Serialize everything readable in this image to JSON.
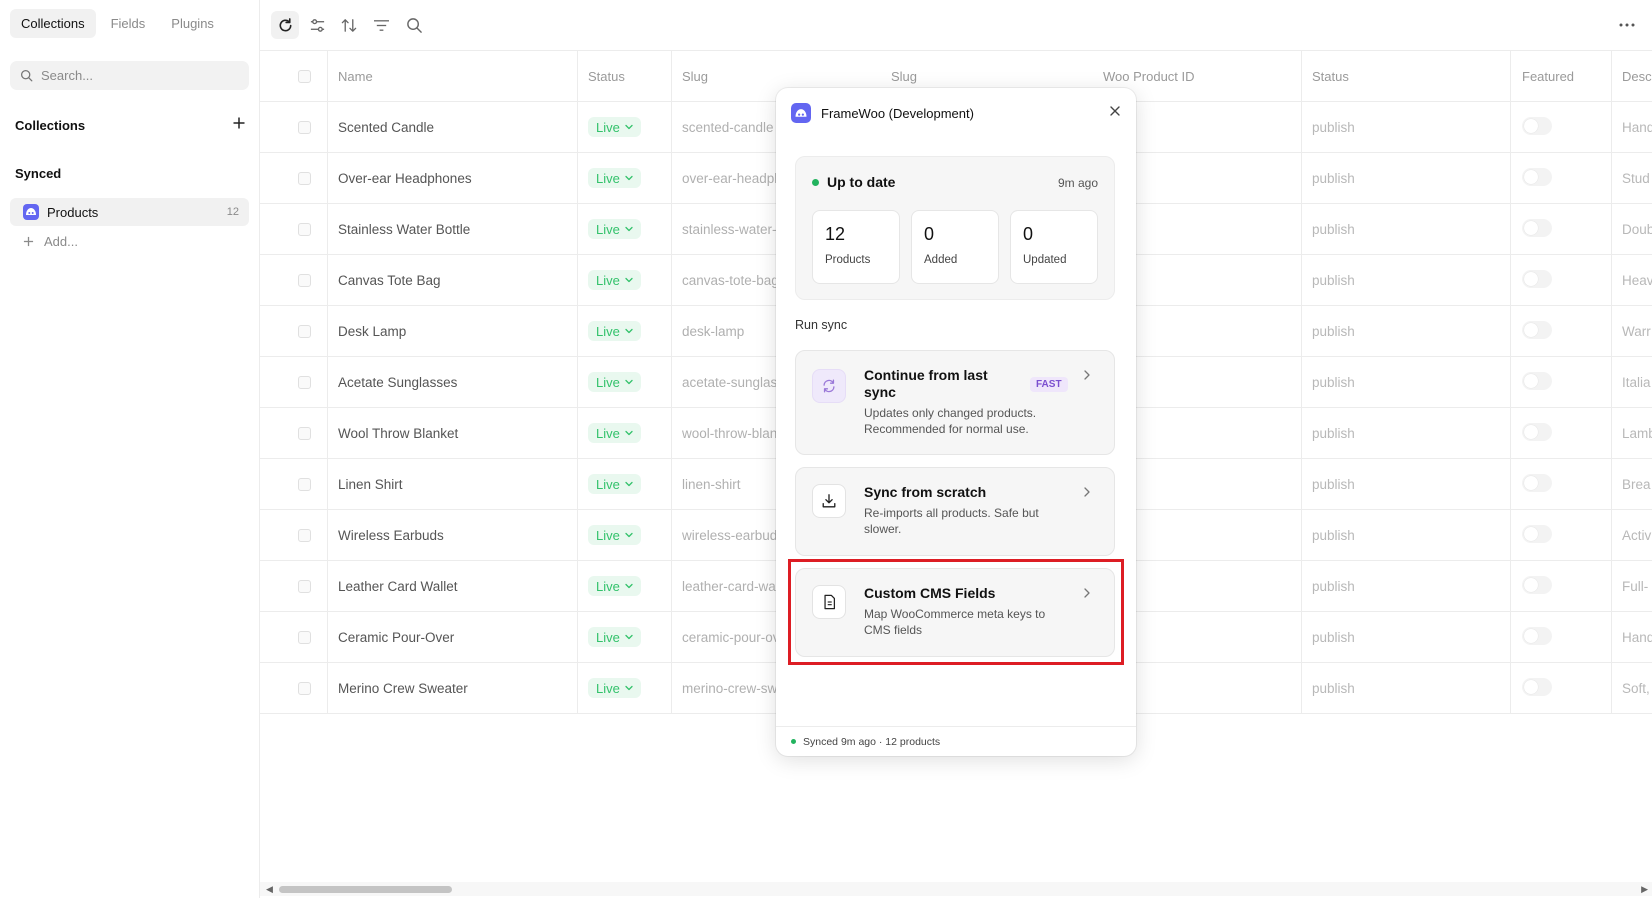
{
  "sidebar": {
    "tabs": [
      "Collections",
      "Fields",
      "Plugins"
    ],
    "search_placeholder": "Search...",
    "collections_title": "Collections",
    "synced_title": "Synced",
    "products_label": "Products",
    "products_count": "12",
    "add_label": "Add..."
  },
  "table": {
    "headers": [
      "Name",
      "Status",
      "Slug",
      "Slug",
      "Woo Product ID",
      "Status",
      "Featured",
      "Desc"
    ],
    "rows": [
      {
        "name": "Scented Candle",
        "status": "Live",
        "slug": "scented-candle",
        "pub": "publish",
        "desc": "Hand"
      },
      {
        "name": "Over-ear Headphones",
        "status": "Live",
        "slug": "over-ear-headphones",
        "pub": "publish",
        "desc": "Stud"
      },
      {
        "name": "Stainless Water Bottle",
        "status": "Live",
        "slug": "stainless-water-bottle",
        "pub": "publish",
        "desc": "Doub"
      },
      {
        "name": "Canvas Tote Bag",
        "status": "Live",
        "slug": "canvas-tote-bag",
        "pub": "publish",
        "desc": "Heav"
      },
      {
        "name": "Desk Lamp",
        "status": "Live",
        "slug": "desk-lamp",
        "pub": "publish",
        "desc": "Warr"
      },
      {
        "name": "Acetate Sunglasses",
        "status": "Live",
        "slug": "acetate-sunglasses",
        "pub": "publish",
        "desc": "Italia"
      },
      {
        "name": "Wool Throw Blanket",
        "status": "Live",
        "slug": "wool-throw-blanket",
        "pub": "publish",
        "desc": "Lamb"
      },
      {
        "name": "Linen Shirt",
        "status": "Live",
        "slug": "linen-shirt",
        "pub": "publish",
        "desc": "Brea"
      },
      {
        "name": "Wireless Earbuds",
        "status": "Live",
        "slug": "wireless-earbuds",
        "pub": "publish",
        "desc": "Activ"
      },
      {
        "name": "Leather Card Wallet",
        "status": "Live",
        "slug": "leather-card-wallet",
        "pub": "publish",
        "desc": "Full-"
      },
      {
        "name": "Ceramic Pour-Over",
        "status": "Live",
        "slug": "ceramic-pour-over",
        "pub": "publish",
        "desc": "Hand"
      },
      {
        "name": "Merino Crew Sweater",
        "status": "Live",
        "slug": "merino-crew-sweater",
        "pub": "publish",
        "desc": "Soft,"
      }
    ]
  },
  "dialog": {
    "title": "FrameWoo (Development)",
    "status_title": "Up to date",
    "status_time": "9m ago",
    "stats": [
      {
        "num": "12",
        "label": "Products"
      },
      {
        "num": "0",
        "label": "Added"
      },
      {
        "num": "0",
        "label": "Updated"
      }
    ],
    "run_label": "Run sync",
    "actions": [
      {
        "title": "Continue from last sync",
        "desc": "Updates only changed products. Recommended for normal use.",
        "badge": "FAST",
        "icon": "refresh-icon"
      },
      {
        "title": "Sync from scratch",
        "desc": "Re-imports all products. Safe but slower.",
        "icon": "download-icon"
      },
      {
        "title": "Custom CMS Fields",
        "desc": "Map WooCommerce meta keys to CMS fields",
        "icon": "document-icon"
      }
    ],
    "footer": "Synced 9m ago · 12 products"
  },
  "colors": {
    "accent": "#6366f1",
    "live_green": "#33c26b",
    "highlight_red": "#dd1d24"
  }
}
